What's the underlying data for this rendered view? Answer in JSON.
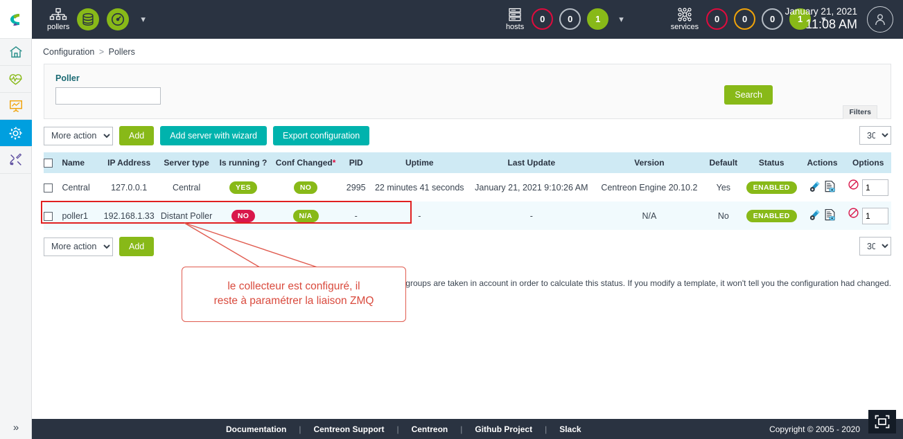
{
  "topbar": {
    "pollers_label": "pollers",
    "pollers_icon": "network-tree-icon",
    "database_icon": "database-icon",
    "engine_icon": "gauge-icon",
    "pollers_chevron": "chevron-down-icon",
    "hosts": {
      "label": "hosts",
      "icon": "server-stack-icon",
      "counters": [
        {
          "value": "0",
          "state": "down",
          "color": "#e00b3d"
        },
        {
          "value": "0",
          "state": "unreachable",
          "color": "#b5bcc4"
        },
        {
          "value": "1",
          "state": "up",
          "color": "#88b918"
        }
      ],
      "chevron": "chevron-down-icon"
    },
    "services": {
      "label": "services",
      "icon": "services-grid-icon",
      "counters": [
        {
          "value": "0",
          "state": "critical",
          "color": "#e00b3d"
        },
        {
          "value": "0",
          "state": "warning",
          "color": "#f0a30a"
        },
        {
          "value": "0",
          "state": "unknown",
          "color": "#b5bcc4"
        },
        {
          "value": "1",
          "state": "ok",
          "color": "#88b918"
        }
      ],
      "chevron": "chevron-down-icon"
    },
    "date": "January 21, 2021",
    "time": "11:08 AM",
    "avatar_icon": "user-avatar-icon"
  },
  "sidebar": {
    "logo_icon": "centreon-logo-icon",
    "items": [
      {
        "name": "home",
        "icon": "home-icon",
        "color": "#2a8f8a",
        "active": false
      },
      {
        "name": "monitoring",
        "icon": "heartbeat-icon",
        "color": "#88b918",
        "active": false
      },
      {
        "name": "reporting",
        "icon": "chart-board-icon",
        "color": "#f0a30a",
        "active": false
      },
      {
        "name": "configuration",
        "icon": "gear-icon",
        "color": "#ffffff",
        "active": true
      },
      {
        "name": "administration",
        "icon": "tools-icon",
        "color": "#5b4b9e",
        "active": false
      }
    ],
    "expand_icon": "double-chevron-right-icon"
  },
  "breadcrumb": {
    "parent": "Configuration",
    "separator": ">",
    "current": "Pollers"
  },
  "filters": {
    "poller_label": "Poller",
    "poller_value": "",
    "poller_placeholder": "",
    "search_label": "Search",
    "filters_tab_label": "Filters"
  },
  "toolbar": {
    "more_actions_label": "More actions...",
    "add_label": "Add",
    "wizard_label": "Add server with wizard",
    "export_label": "Export configuration",
    "page_size": "30"
  },
  "toolbar_bottom": {
    "more_actions_label": "More actions...",
    "add_label": "Add",
    "page_size": "30"
  },
  "table": {
    "columns": [
      "Name",
      "IP Address",
      "Server type",
      "Is running ?",
      "Conf Changed",
      "PID",
      "Uptime",
      "Last Update",
      "Version",
      "Default",
      "Status",
      "Actions",
      "Options"
    ],
    "conf_changed_required_marker": "*",
    "rows": [
      {
        "name": "Central",
        "ip": "127.0.0.1",
        "server_type": "Central",
        "is_running": "YES",
        "is_running_state": "yes",
        "conf_changed": "NO",
        "conf_changed_state": "no",
        "pid": "2995",
        "uptime": "22 minutes 41 seconds",
        "last_update": "January 21, 2021 9:10:26 AM",
        "version": "Centreon Engine 20.10.2",
        "default": "Yes",
        "status": "ENABLED",
        "option_value": "1",
        "highlighted": false
      },
      {
        "name": "poller1",
        "ip": "192.168.1.33",
        "server_type": "Distant Poller",
        "is_running": "NO",
        "is_running_state": "no",
        "conf_changed": "N/A",
        "conf_changed_state": "na",
        "pid": "-",
        "uptime": "-",
        "last_update": "-",
        "version": "N/A",
        "default": "No",
        "status": "ENABLED",
        "option_value": "1",
        "highlighted": true
      }
    ],
    "action_icons": [
      "edit-gear-icon",
      "document-view-icon"
    ],
    "deny_icon": "deny-circle-icon",
    "select_all_icon": "checkbox-icon"
  },
  "note": "hostgroups are taken in account in order to calculate this status. If you modify a template, it won't tell you the configuration had changed.",
  "annotation": {
    "text_line1": "le collecteur est configuré, il",
    "text_line2": "reste à paramétrer la liaison ZMQ",
    "border_color": "#e05a4e",
    "text_color": "#d94a3d"
  },
  "footer": {
    "links": [
      "Documentation",
      "Centreon Support",
      "Centreon",
      "Github Project",
      "Slack"
    ],
    "separator": "|",
    "copyright": "Copyright © 2005 - 2020"
  },
  "snapshot_icon": "screenshot-capture-icon"
}
